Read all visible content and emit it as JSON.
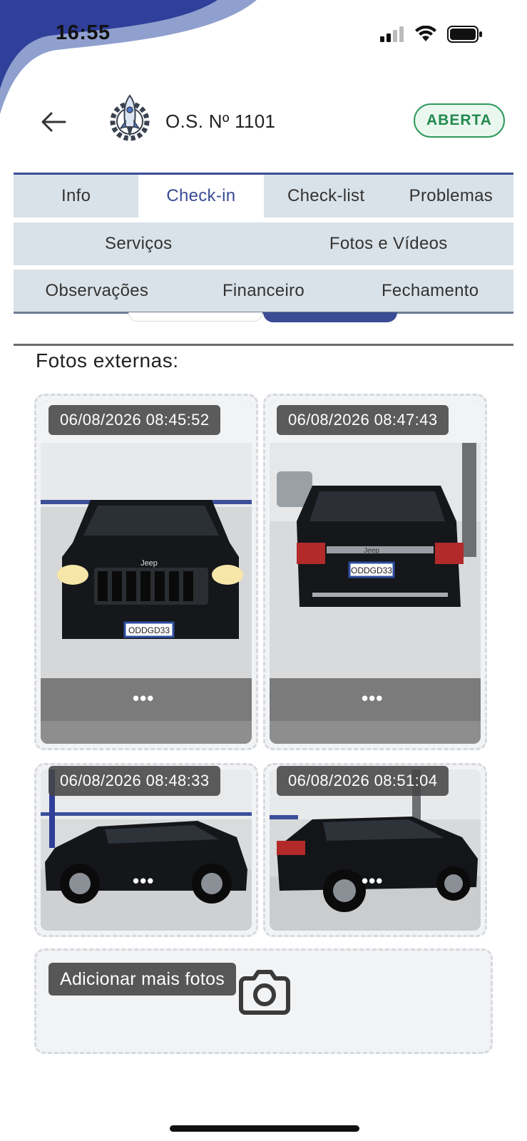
{
  "status_bar": {
    "time": "16:55",
    "icons": [
      "signal-icon",
      "wifi-icon",
      "battery-icon"
    ]
  },
  "header": {
    "back_icon": "arrow-left-icon",
    "logo": "rocket-gear-logo",
    "title": "O.S. Nº 1101",
    "status": "ABERTA"
  },
  "tabs": {
    "row1": [
      "Info",
      "Check-in",
      "Check-list",
      "Problemas"
    ],
    "row2": [
      "Serviços",
      "Fotos e Vídeos"
    ],
    "row3": [
      "Observações",
      "Financeiro",
      "Fechamento"
    ],
    "active": "Check-in"
  },
  "section": {
    "title": "Fotos externas:"
  },
  "photos": [
    {
      "timestamp": "06/08/2026 08:45:52",
      "more": "•••",
      "plate": "ODDGD33",
      "brand": "Jeep"
    },
    {
      "timestamp": "06/08/2026 08:47:43",
      "more": "•••",
      "plate": "ODDGD33",
      "brand": "Jeep"
    },
    {
      "timestamp": "06/08/2026 08:48:33",
      "more": "•••"
    },
    {
      "timestamp": "06/08/2026 08:51:04",
      "more": "•••"
    }
  ],
  "add_photos": {
    "label": "Adicionar mais fotos",
    "icon": "camera-icon"
  },
  "colors": {
    "primary": "#3b4c94",
    "tab_bg": "#d9e2e8",
    "status_green": "#2e9a5a",
    "status_green_bg": "#eaf7ef"
  }
}
